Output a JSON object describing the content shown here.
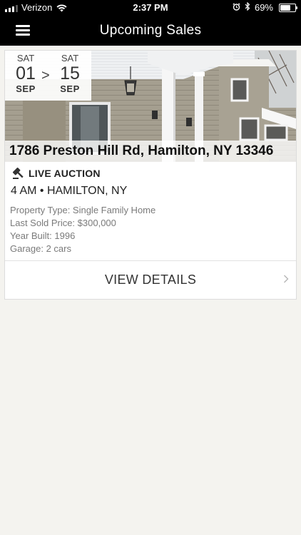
{
  "status_bar": {
    "carrier": "Verizon",
    "time": "2:37 PM",
    "battery": "69%",
    "battery_level": 0.69
  },
  "nav": {
    "title": "Upcoming Sales",
    "menu_icon": "hamburger-menu-icon"
  },
  "sale": {
    "start": {
      "dow": "SAT",
      "day": "01",
      "month": "SEP"
    },
    "separator": ">",
    "end": {
      "dow": "SAT",
      "day": "15",
      "month": "SEP"
    },
    "address": "1786 Preston Hill Rd, Hamilton, NY 13346",
    "type_icon": "gavel-icon",
    "type_label": "LIVE AUCTION",
    "time_location": "4 AM • HAMILTON, NY",
    "details": [
      "Property Type: Single Family Home",
      "Last Sold Price: $300,000",
      "Year Built: 1996",
      "Garage: 2 cars"
    ],
    "action_label": "VIEW DETAILS"
  },
  "colors": {
    "bar": "#000000",
    "page_background": "#f4f3ef",
    "card_background": "#ffffff",
    "detail_text": "#7a7a7a"
  }
}
